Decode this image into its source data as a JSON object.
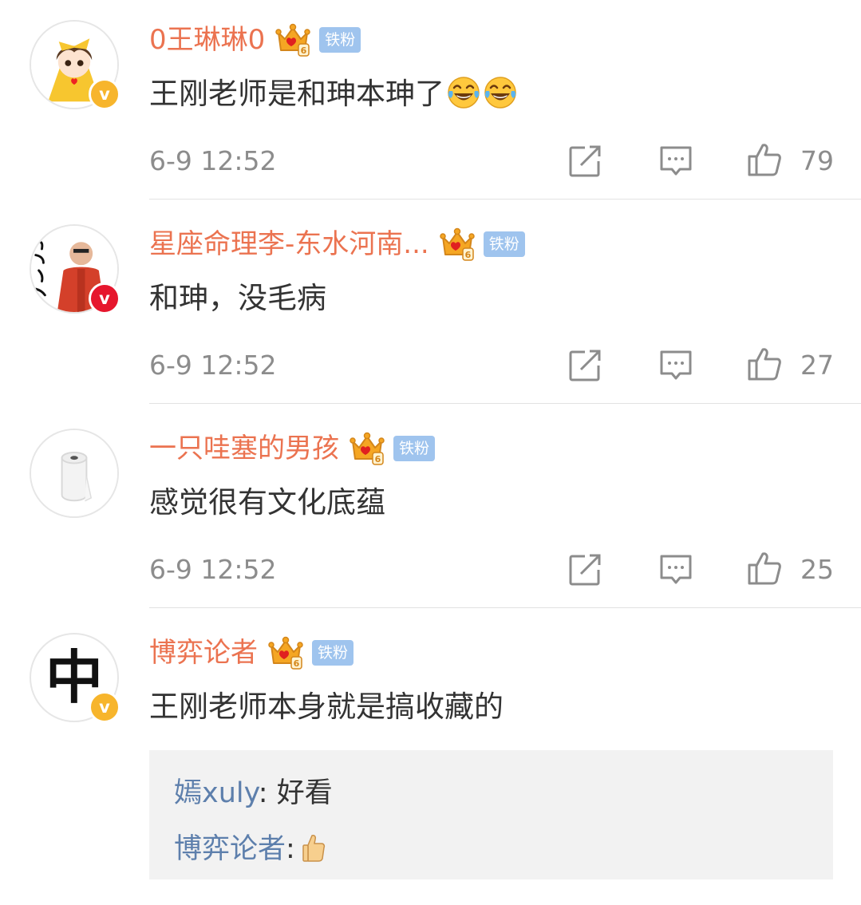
{
  "colors": {
    "username": "#eb7350",
    "fan_badge": "#9fc4ee",
    "verified_yellow": "#f7b52c",
    "verified_red": "#e6162d",
    "reply_name": "#5d7fac"
  },
  "comments": [
    {
      "username": "0王琳琳0",
      "fan_badge": "铁粉",
      "text": "王刚老师是和珅本珅了",
      "emojis": [
        "laugh-cry-emoji",
        "laugh-cry-emoji"
      ],
      "time": "6-9 12:52",
      "likes": "79",
      "verified": "yellow"
    },
    {
      "username": "星座命理李-东水河南...",
      "fan_badge": "铁粉",
      "text": "和珅，没毛病",
      "time": "6-9 12:52",
      "likes": "27",
      "verified": "red"
    },
    {
      "username": "一只哇塞的男孩",
      "fan_badge": "铁粉",
      "text": "感觉很有文化底蕴",
      "time": "6-9 12:52",
      "likes": "25",
      "verified": "none"
    },
    {
      "username": "博弈论者",
      "fan_badge": "铁粉",
      "text": "王刚老师本身就是搞收藏的",
      "verified": "yellow",
      "avatar_char": "中",
      "replies": [
        {
          "name": "嫣xuly",
          "sep": ": ",
          "text": "好看"
        },
        {
          "name": "博弈论者",
          "sep": ":",
          "emoji": "thumbs-up-emoji"
        }
      ]
    }
  ]
}
